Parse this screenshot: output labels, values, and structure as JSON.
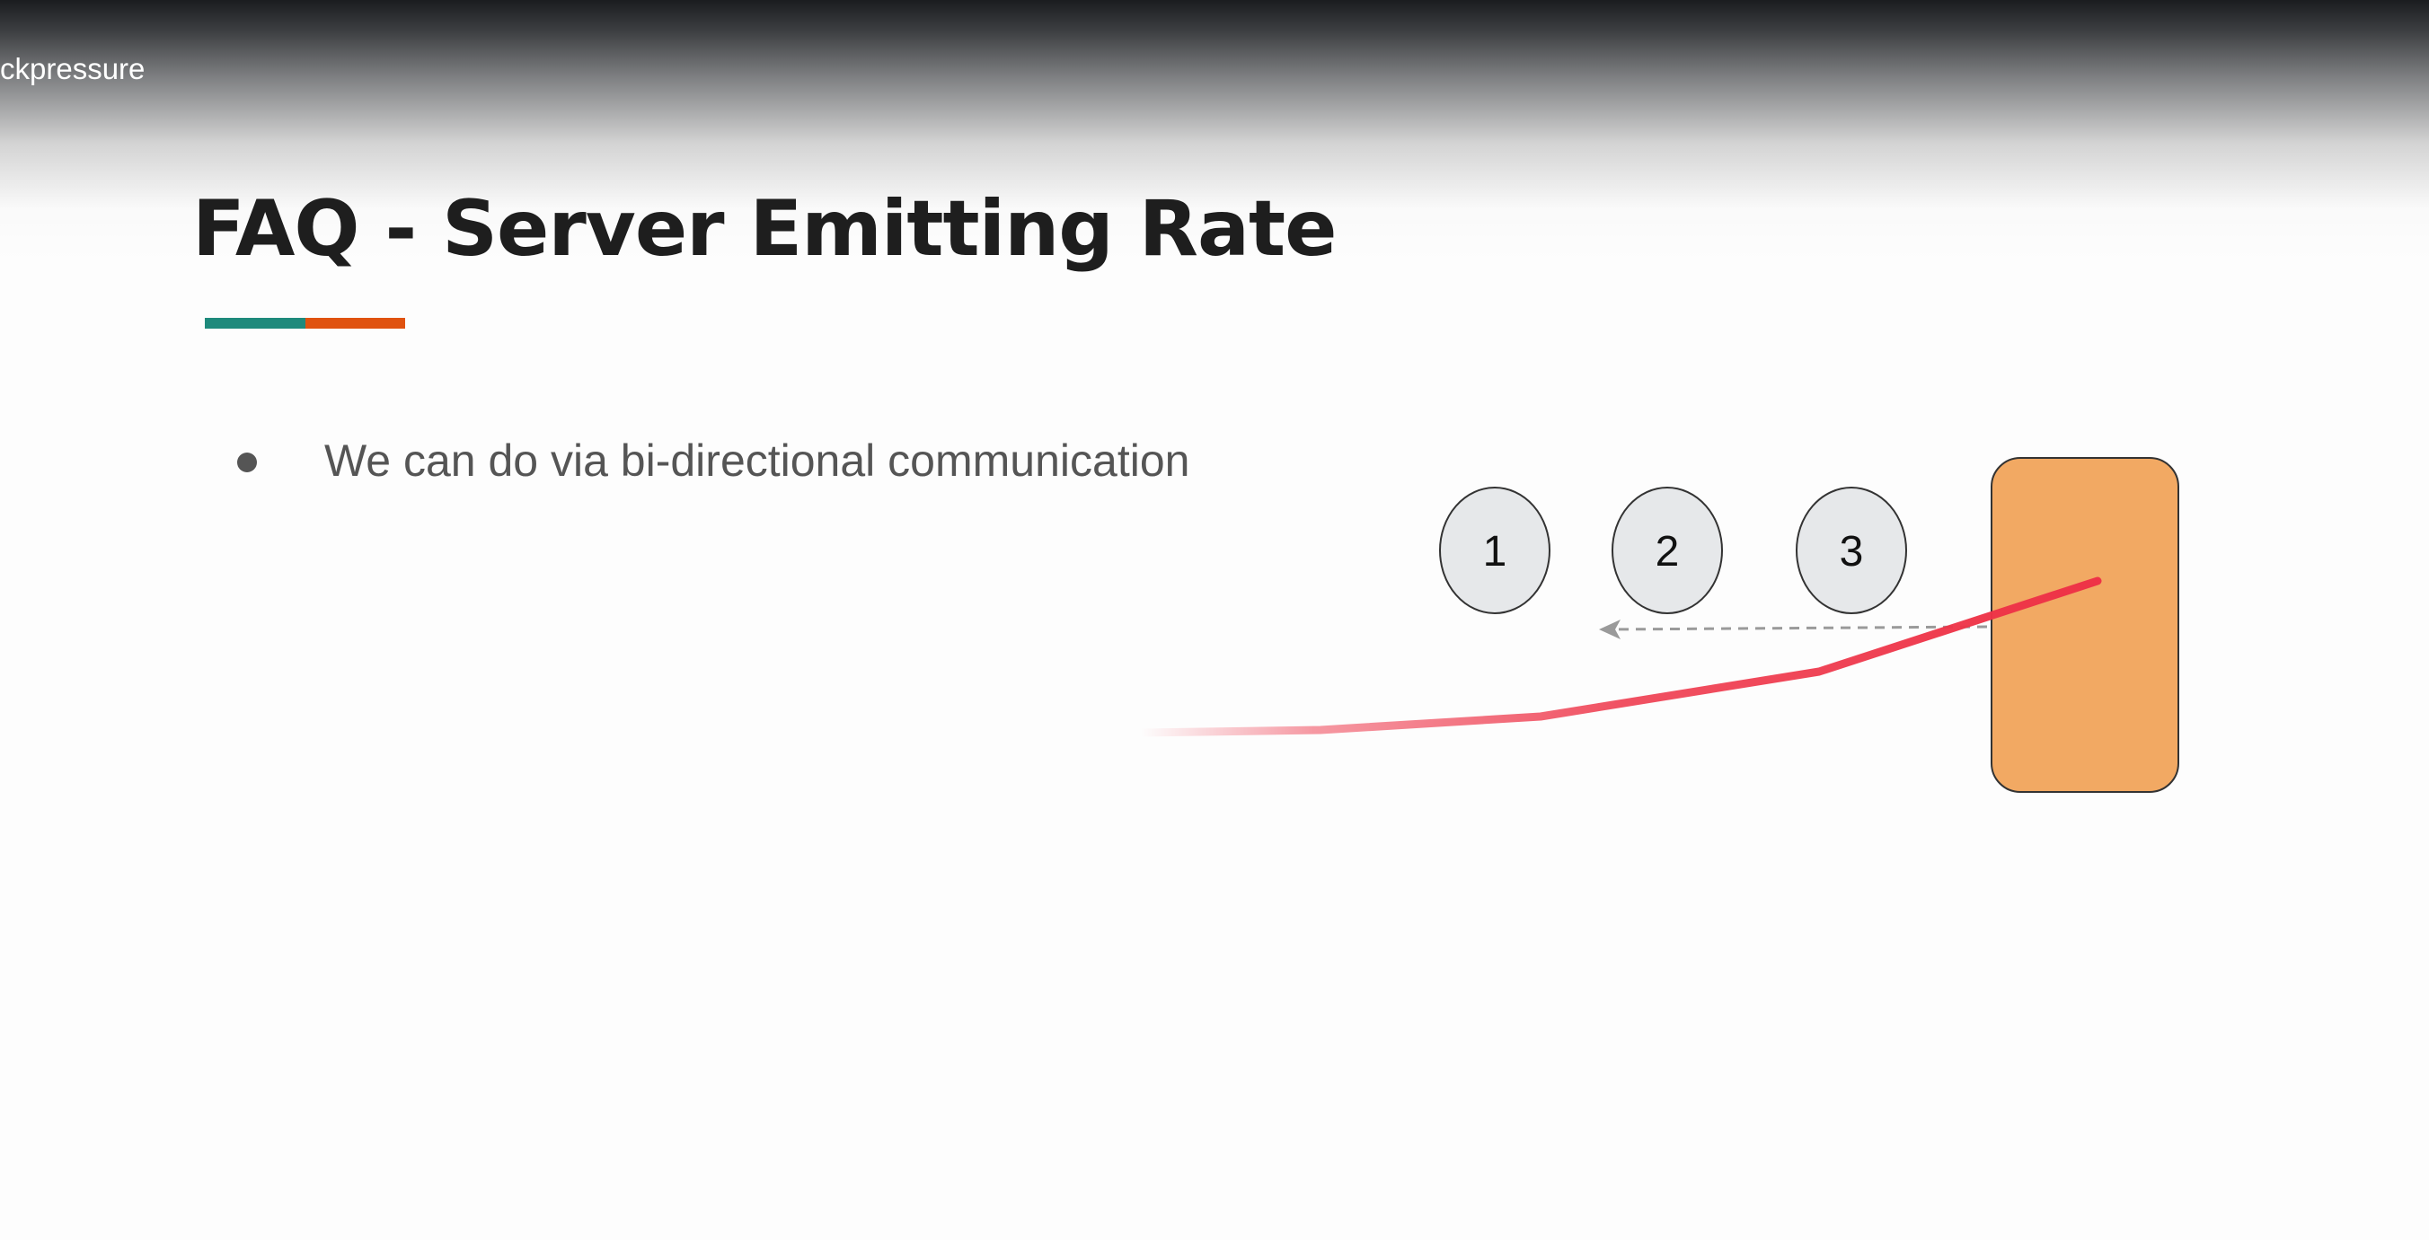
{
  "video": {
    "title": "ckpressure"
  },
  "slide": {
    "title": "FAQ - Server Emitting Rate",
    "accent_colors": [
      "#1e8a7c",
      "#e0520f"
    ],
    "bullets": [
      "We can do via bi-directional communication"
    ]
  },
  "diagram": {
    "items": [
      {
        "label": "1"
      },
      {
        "label": "2"
      },
      {
        "label": "3"
      }
    ],
    "server_color": "#f2a963",
    "item_color": "#e6e8ea",
    "arrow_style": "dashed",
    "annotation_color": "#ee3347"
  }
}
